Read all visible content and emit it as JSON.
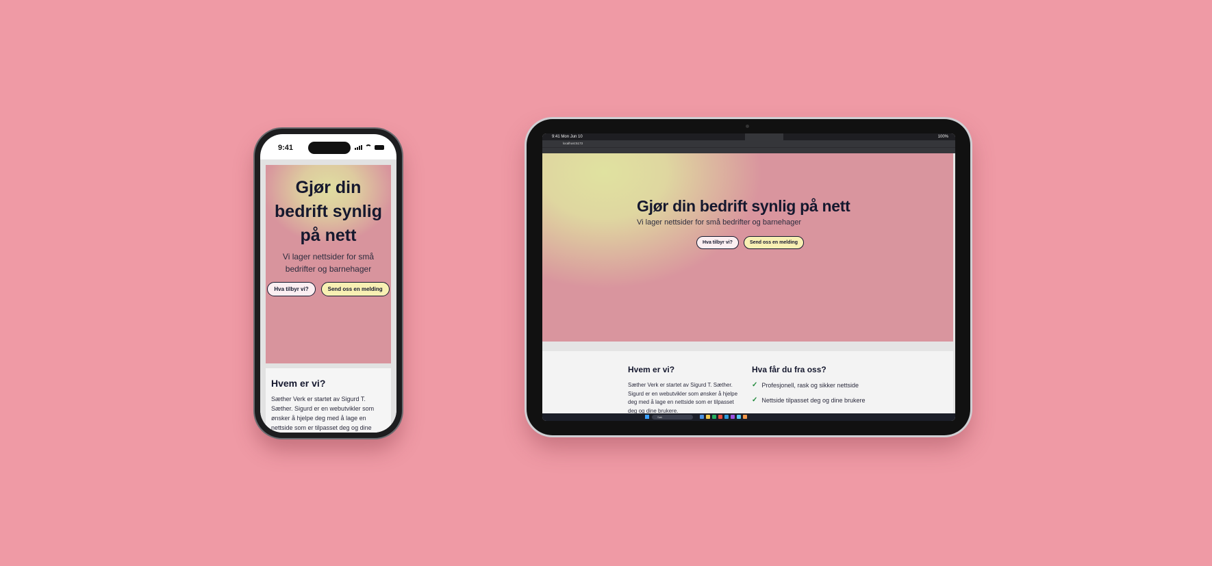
{
  "colors": {
    "background": "#ef9aa5",
    "hero_pink": "#d9959e",
    "hero_yellow": "#e0e2a0",
    "text_dark": "#15182e",
    "button_light": "#fbeef1",
    "button_yellow": "#f8f0b3",
    "check_green": "#1e8a3a"
  },
  "phone": {
    "status_time": "9:41",
    "hero": {
      "title": "Gjør din bedrift synlig på nett",
      "subtitle": "Vi lager nettsider for små bedrifter og barnehager",
      "button_primary": "Hva tilbyr vi?",
      "button_secondary": "Send oss en melding"
    },
    "about": {
      "heading": "Hvem er vi?",
      "text": "Sæther Verk er startet av Sigurd T. Sæther. Sigurd er en webutvikler som ønsker å hjelpe deg med å lage en nettside som er tilpasset deg og dine brukere."
    }
  },
  "tablet": {
    "status_time": "9:41",
    "status_date": "Mon Jun 10",
    "status_battery": "100%",
    "url": "localhost:5173",
    "hero": {
      "title": "Gjør din bedrift synlig på nett",
      "subtitle": "Vi lager nettsider for små bedrifter og barnehager",
      "button_primary": "Hva tilbyr vi?",
      "button_secondary": "Send oss en melding"
    },
    "about": {
      "heading": "Hvem er vi?",
      "text": "Sæther Verk er startet av Sigurd T. Sæther. Sigurd er en webutvikler som ønsker å hjelpe deg med å lage en nettside som er tilpasset deg og dine brukere."
    },
    "offer": {
      "heading": "Hva får du fra oss?",
      "items": [
        "Profesjonell, rask og sikker nettside",
        "Nettside tilpasset deg og dine brukere"
      ]
    },
    "taskbar_search": "Søk"
  }
}
